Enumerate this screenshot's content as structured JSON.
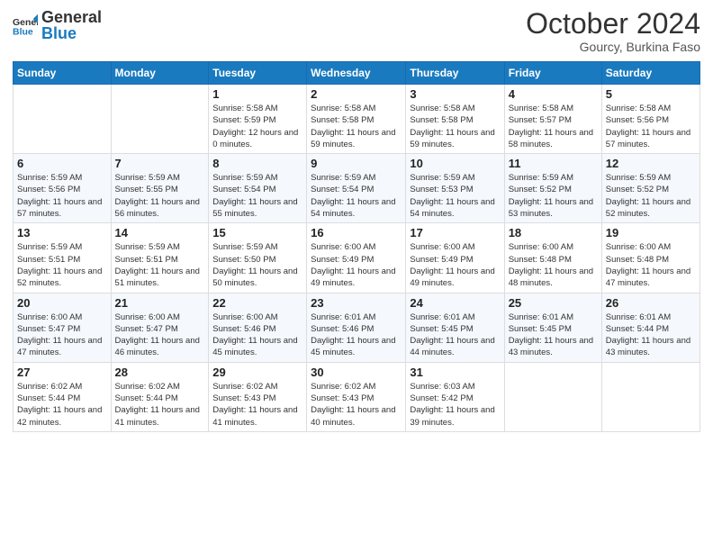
{
  "logo": {
    "text_general": "General",
    "text_blue": "Blue"
  },
  "title": "October 2024",
  "location": "Gourcy, Burkina Faso",
  "days_of_week": [
    "Sunday",
    "Monday",
    "Tuesday",
    "Wednesday",
    "Thursday",
    "Friday",
    "Saturday"
  ],
  "weeks": [
    [
      {
        "day": "",
        "sunrise": "",
        "sunset": "",
        "daylight": ""
      },
      {
        "day": "",
        "sunrise": "",
        "sunset": "",
        "daylight": ""
      },
      {
        "day": "1",
        "sunrise": "Sunrise: 5:58 AM",
        "sunset": "Sunset: 5:59 PM",
        "daylight": "Daylight: 12 hours and 0 minutes."
      },
      {
        "day": "2",
        "sunrise": "Sunrise: 5:58 AM",
        "sunset": "Sunset: 5:58 PM",
        "daylight": "Daylight: 11 hours and 59 minutes."
      },
      {
        "day": "3",
        "sunrise": "Sunrise: 5:58 AM",
        "sunset": "Sunset: 5:58 PM",
        "daylight": "Daylight: 11 hours and 59 minutes."
      },
      {
        "day": "4",
        "sunrise": "Sunrise: 5:58 AM",
        "sunset": "Sunset: 5:57 PM",
        "daylight": "Daylight: 11 hours and 58 minutes."
      },
      {
        "day": "5",
        "sunrise": "Sunrise: 5:58 AM",
        "sunset": "Sunset: 5:56 PM",
        "daylight": "Daylight: 11 hours and 57 minutes."
      }
    ],
    [
      {
        "day": "6",
        "sunrise": "Sunrise: 5:59 AM",
        "sunset": "Sunset: 5:56 PM",
        "daylight": "Daylight: 11 hours and 57 minutes."
      },
      {
        "day": "7",
        "sunrise": "Sunrise: 5:59 AM",
        "sunset": "Sunset: 5:55 PM",
        "daylight": "Daylight: 11 hours and 56 minutes."
      },
      {
        "day": "8",
        "sunrise": "Sunrise: 5:59 AM",
        "sunset": "Sunset: 5:54 PM",
        "daylight": "Daylight: 11 hours and 55 minutes."
      },
      {
        "day": "9",
        "sunrise": "Sunrise: 5:59 AM",
        "sunset": "Sunset: 5:54 PM",
        "daylight": "Daylight: 11 hours and 54 minutes."
      },
      {
        "day": "10",
        "sunrise": "Sunrise: 5:59 AM",
        "sunset": "Sunset: 5:53 PM",
        "daylight": "Daylight: 11 hours and 54 minutes."
      },
      {
        "day": "11",
        "sunrise": "Sunrise: 5:59 AM",
        "sunset": "Sunset: 5:52 PM",
        "daylight": "Daylight: 11 hours and 53 minutes."
      },
      {
        "day": "12",
        "sunrise": "Sunrise: 5:59 AM",
        "sunset": "Sunset: 5:52 PM",
        "daylight": "Daylight: 11 hours and 52 minutes."
      }
    ],
    [
      {
        "day": "13",
        "sunrise": "Sunrise: 5:59 AM",
        "sunset": "Sunset: 5:51 PM",
        "daylight": "Daylight: 11 hours and 52 minutes."
      },
      {
        "day": "14",
        "sunrise": "Sunrise: 5:59 AM",
        "sunset": "Sunset: 5:51 PM",
        "daylight": "Daylight: 11 hours and 51 minutes."
      },
      {
        "day": "15",
        "sunrise": "Sunrise: 5:59 AM",
        "sunset": "Sunset: 5:50 PM",
        "daylight": "Daylight: 11 hours and 50 minutes."
      },
      {
        "day": "16",
        "sunrise": "Sunrise: 6:00 AM",
        "sunset": "Sunset: 5:49 PM",
        "daylight": "Daylight: 11 hours and 49 minutes."
      },
      {
        "day": "17",
        "sunrise": "Sunrise: 6:00 AM",
        "sunset": "Sunset: 5:49 PM",
        "daylight": "Daylight: 11 hours and 49 minutes."
      },
      {
        "day": "18",
        "sunrise": "Sunrise: 6:00 AM",
        "sunset": "Sunset: 5:48 PM",
        "daylight": "Daylight: 11 hours and 48 minutes."
      },
      {
        "day": "19",
        "sunrise": "Sunrise: 6:00 AM",
        "sunset": "Sunset: 5:48 PM",
        "daylight": "Daylight: 11 hours and 47 minutes."
      }
    ],
    [
      {
        "day": "20",
        "sunrise": "Sunrise: 6:00 AM",
        "sunset": "Sunset: 5:47 PM",
        "daylight": "Daylight: 11 hours and 47 minutes."
      },
      {
        "day": "21",
        "sunrise": "Sunrise: 6:00 AM",
        "sunset": "Sunset: 5:47 PM",
        "daylight": "Daylight: 11 hours and 46 minutes."
      },
      {
        "day": "22",
        "sunrise": "Sunrise: 6:00 AM",
        "sunset": "Sunset: 5:46 PM",
        "daylight": "Daylight: 11 hours and 45 minutes."
      },
      {
        "day": "23",
        "sunrise": "Sunrise: 6:01 AM",
        "sunset": "Sunset: 5:46 PM",
        "daylight": "Daylight: 11 hours and 45 minutes."
      },
      {
        "day": "24",
        "sunrise": "Sunrise: 6:01 AM",
        "sunset": "Sunset: 5:45 PM",
        "daylight": "Daylight: 11 hours and 44 minutes."
      },
      {
        "day": "25",
        "sunrise": "Sunrise: 6:01 AM",
        "sunset": "Sunset: 5:45 PM",
        "daylight": "Daylight: 11 hours and 43 minutes."
      },
      {
        "day": "26",
        "sunrise": "Sunrise: 6:01 AM",
        "sunset": "Sunset: 5:44 PM",
        "daylight": "Daylight: 11 hours and 43 minutes."
      }
    ],
    [
      {
        "day": "27",
        "sunrise": "Sunrise: 6:02 AM",
        "sunset": "Sunset: 5:44 PM",
        "daylight": "Daylight: 11 hours and 42 minutes."
      },
      {
        "day": "28",
        "sunrise": "Sunrise: 6:02 AM",
        "sunset": "Sunset: 5:44 PM",
        "daylight": "Daylight: 11 hours and 41 minutes."
      },
      {
        "day": "29",
        "sunrise": "Sunrise: 6:02 AM",
        "sunset": "Sunset: 5:43 PM",
        "daylight": "Daylight: 11 hours and 41 minutes."
      },
      {
        "day": "30",
        "sunrise": "Sunrise: 6:02 AM",
        "sunset": "Sunset: 5:43 PM",
        "daylight": "Daylight: 11 hours and 40 minutes."
      },
      {
        "day": "31",
        "sunrise": "Sunrise: 6:03 AM",
        "sunset": "Sunset: 5:42 PM",
        "daylight": "Daylight: 11 hours and 39 minutes."
      },
      {
        "day": "",
        "sunrise": "",
        "sunset": "",
        "daylight": ""
      },
      {
        "day": "",
        "sunrise": "",
        "sunset": "",
        "daylight": ""
      }
    ]
  ]
}
